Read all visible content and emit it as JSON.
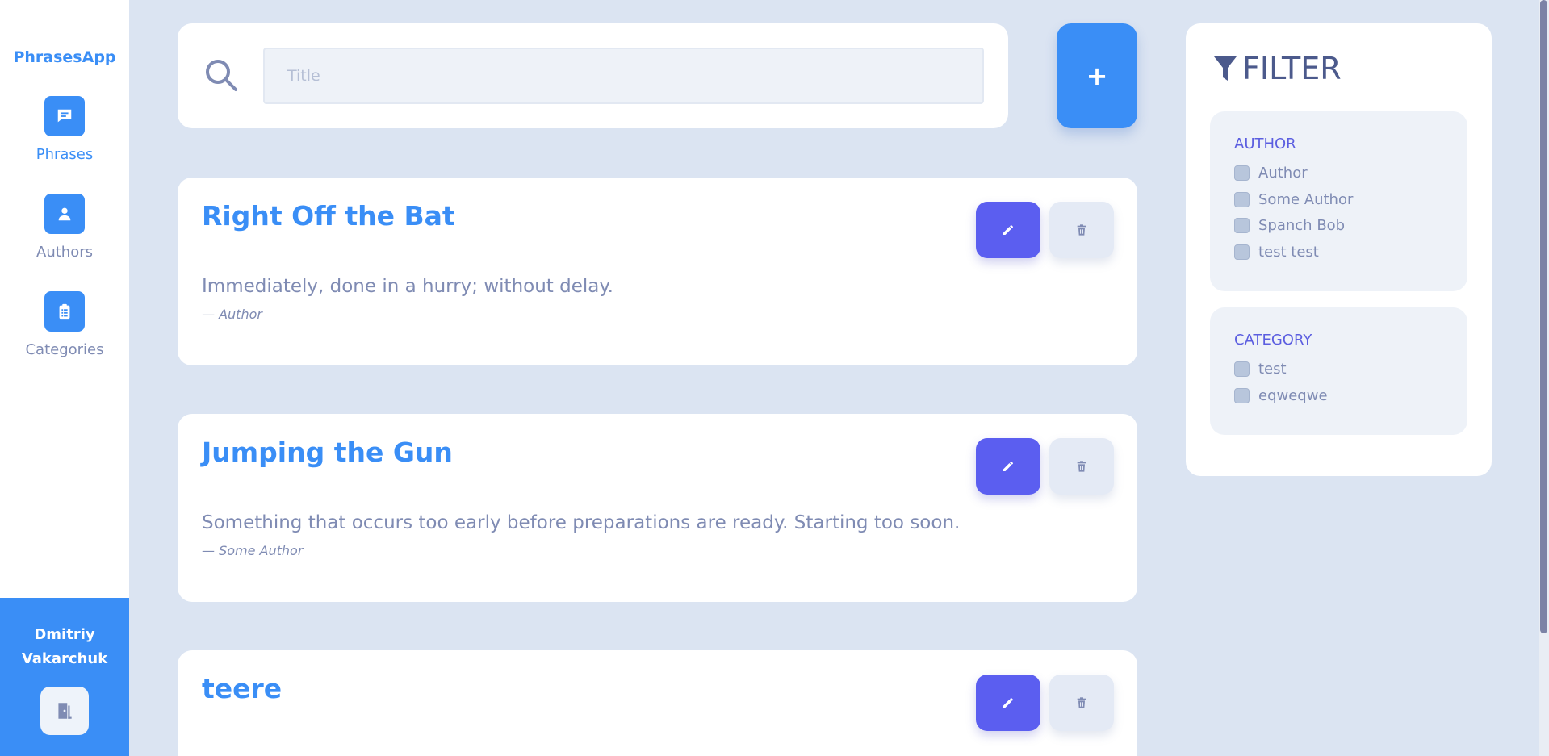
{
  "app": {
    "title": "PhrasesApp"
  },
  "sidebar": {
    "items": [
      {
        "label": "Phrases",
        "icon": "message-icon",
        "active": true
      },
      {
        "label": "Authors",
        "icon": "user-icon",
        "active": false
      },
      {
        "label": "Categories",
        "icon": "clipboard-list-icon",
        "active": false
      }
    ],
    "user": {
      "first_name": "Dmitriy",
      "last_name": "Vakarchuk",
      "logout_icon": "door-exit-icon"
    }
  },
  "search": {
    "placeholder": "Title",
    "value": ""
  },
  "add_button": {
    "label": "+"
  },
  "phrases": [
    {
      "title": "Right Off the Bat",
      "text": "Immediately, done in a hurry; without delay.",
      "author": "—  Author"
    },
    {
      "title": "Jumping the Gun",
      "text": "Something that occurs too early before preparations are ready. Starting too soon.",
      "author": "— Some Author"
    },
    {
      "title": "teere",
      "text": "",
      "author": ""
    }
  ],
  "filter": {
    "title": "FILTER",
    "author": {
      "title": "AUTHOR",
      "options": [
        "Author",
        "Some Author",
        "Spanch Bob",
        "test test"
      ]
    },
    "category": {
      "title": "CATEGORY",
      "options": [
        "test",
        "eqweqwe"
      ]
    }
  },
  "colors": {
    "accent": "#3a8ef6",
    "edit": "#5b5ef0",
    "background": "#dbe4f2"
  }
}
